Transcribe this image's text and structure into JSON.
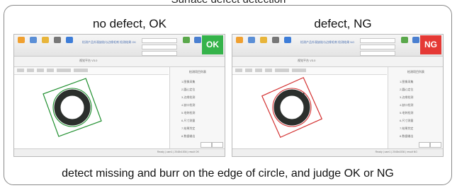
{
  "page": {
    "top_title": "Surface defect detection",
    "caption": "detect missing and burr on the edge of circle, and judge OK or NG"
  },
  "panels": [
    {
      "title": "no defect, OK",
      "result": "OK",
      "result_color": "#35b34a",
      "roi_color": "#1f8f2e",
      "circle_color": "#1f8f2e",
      "subbar_title": "视觉平台 V3.0",
      "info_line": "检测产品外观缺陷与边缘毛刺 检测结果 OK",
      "side_header": "检测项目列表",
      "side_items": [
        "1.图像采集",
        "2.圆心定位",
        "3.边缘检测",
        "4.缺口检测",
        "5.毛刺检测",
        "6.尺寸测量",
        "7.结果判定",
        "8.数据输出"
      ],
      "status": "Ready  |  cam1  |  2048x1536  |  result OK"
    },
    {
      "title": "defect, NG",
      "result": "NG",
      "result_color": "#e53935",
      "roi_color": "#d32f2f",
      "circle_color": "#d32f2f",
      "subbar_title": "视觉平台 V3.0",
      "info_line": "检测产品外观缺陷与边缘毛刺 检测结果 NG",
      "side_header": "检测项目列表",
      "side_items": [
        "1.图像采集",
        "2.圆心定位",
        "3.边缘检测",
        "4.缺口检测",
        "5.毛刺检测",
        "6.尺寸测量",
        "7.结果判定",
        "8.数据输出"
      ],
      "status": "Ready  |  cam1  |  2048x1536  |  result NG"
    }
  ]
}
